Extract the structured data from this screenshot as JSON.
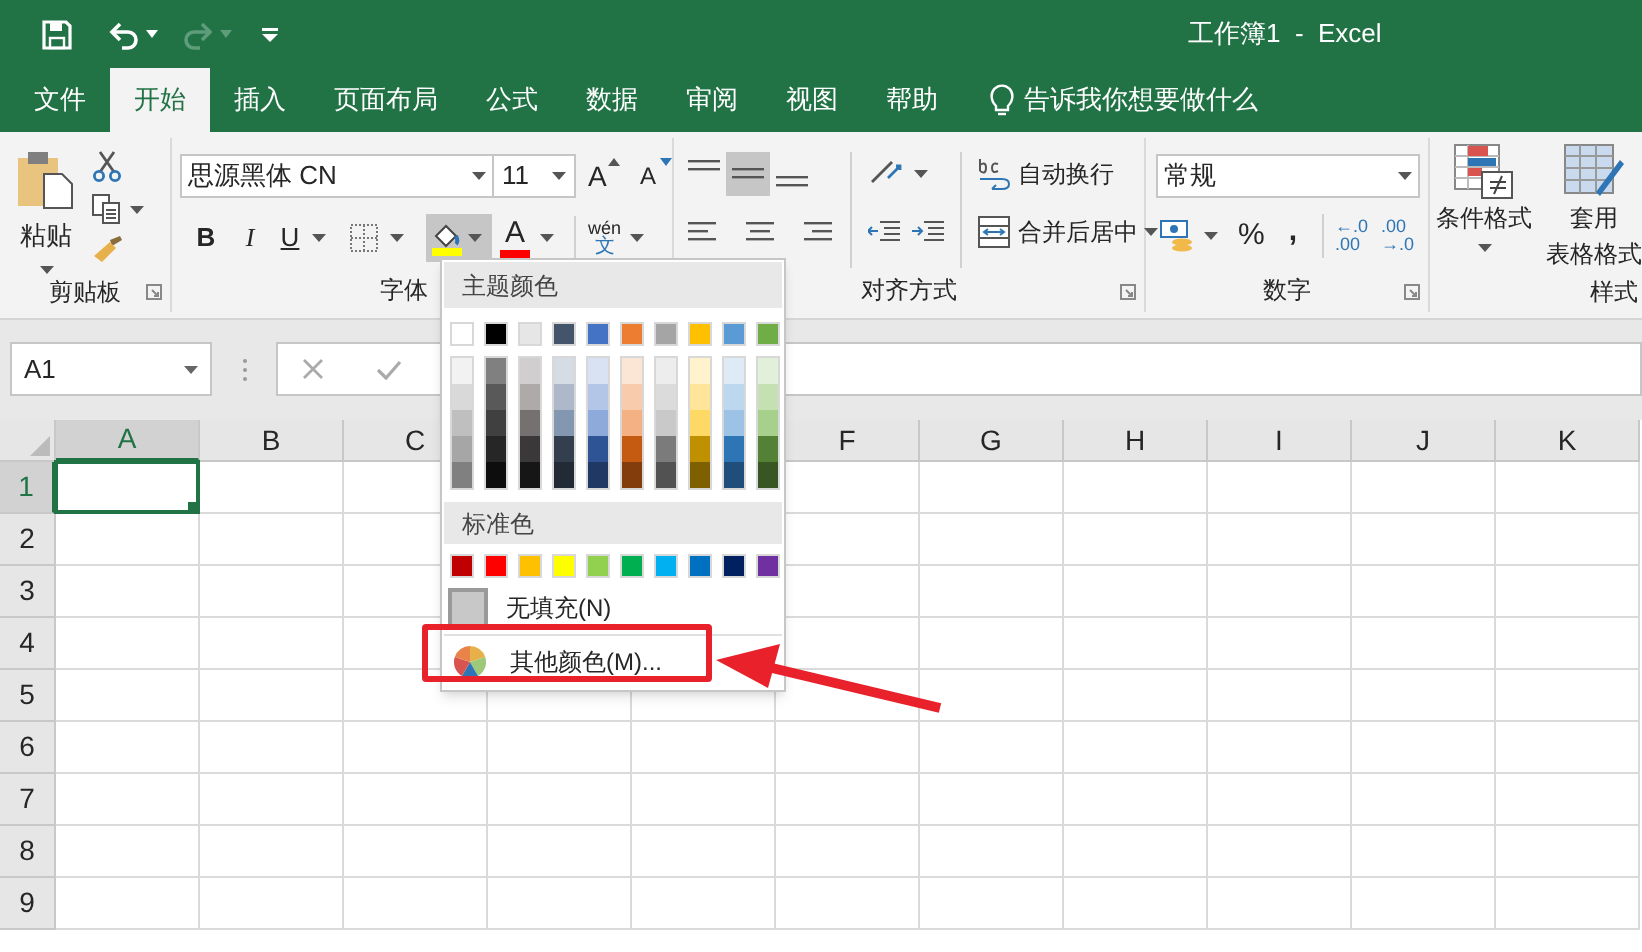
{
  "title_bar": {
    "title": "工作簿1  -  Excel",
    "quick_access": [
      {
        "kind": "undo",
        "disabled": false
      },
      {
        "kind": "redo",
        "disabled": true
      }
    ]
  },
  "tabs": [
    {
      "label": "文件",
      "selected": false
    },
    {
      "label": "开始",
      "selected": true
    },
    {
      "label": "插入",
      "selected": false
    },
    {
      "label": "页面布局",
      "selected": false
    },
    {
      "label": "公式",
      "selected": false
    },
    {
      "label": "数据",
      "selected": false
    },
    {
      "label": "审阅",
      "selected": false
    },
    {
      "label": "视图",
      "selected": false
    },
    {
      "label": "帮助",
      "selected": false
    }
  ],
  "tell_me": "告诉我你想要做什么",
  "ribbon": {
    "clipboard": {
      "paste": "粘贴",
      "label": "剪贴板"
    },
    "font": {
      "font_name": "思源黑体 CN",
      "font_size": "11",
      "grow": "A",
      "shrink": "A",
      "bold": "B",
      "italic": "I",
      "underline": "U",
      "fill_pressed": true,
      "fill_color": {
        "color": "#ffff00"
      },
      "font_color_letter": "A",
      "font_color": {
        "color": "#ff0000"
      },
      "phonetic_top": "wén",
      "phonetic_bottom": "文",
      "label": "字体"
    },
    "alignment": {
      "middle_align_pressed": true,
      "wrap_text": "自动换行",
      "merge_center": "合并后居中",
      "label": "对齐方式"
    },
    "number": {
      "format": "常规",
      "percent": "%",
      "comma": ",",
      "increase_decimal": [
        "←.0",
        ".00"
      ],
      "decrease_decimal": [
        ".00",
        "→.0"
      ],
      "label": "数字"
    },
    "styles": {
      "conditional_formatting": "条件格式",
      "format_as_table": [
        "套用",
        "表格格式"
      ],
      "label": "样式"
    }
  },
  "formula_bar": {
    "name_box": "A1"
  },
  "sheet": {
    "columns_left": [
      {
        "label": "A",
        "selected": true
      },
      {
        "label": "B",
        "selected": false
      },
      {
        "label": "C",
        "selected": false
      }
    ],
    "columns_right": [
      {
        "label": "F",
        "selected": false
      },
      {
        "label": "G",
        "selected": false
      },
      {
        "label": "H",
        "selected": false
      },
      {
        "label": "I",
        "selected": false
      },
      {
        "label": "J",
        "selected": false
      },
      {
        "label": "K",
        "selected": false
      }
    ],
    "rows": [
      {
        "label": "1",
        "selected": true
      },
      {
        "label": "2",
        "selected": false
      },
      {
        "label": "3",
        "selected": false
      },
      {
        "label": "4",
        "selected": false
      },
      {
        "label": "5",
        "selected": false
      },
      {
        "label": "6",
        "selected": false
      },
      {
        "label": "7",
        "selected": false
      },
      {
        "label": "8",
        "selected": false
      },
      {
        "label": "9",
        "selected": false
      }
    ]
  },
  "fill_color_menu": {
    "theme_heading": "主题颜色",
    "theme_colors": [
      {
        "color": "#ffffff",
        "shades": [
          {
            "color": "#f2f2f2"
          },
          {
            "color": "#d9d9d9"
          },
          {
            "color": "#bfbfbf"
          },
          {
            "color": "#a6a6a6"
          },
          {
            "color": "#808080"
          }
        ]
      },
      {
        "color": "#000000",
        "shades": [
          {
            "color": "#808080"
          },
          {
            "color": "#595959"
          },
          {
            "color": "#404040"
          },
          {
            "color": "#262626"
          },
          {
            "color": "#0d0d0d"
          }
        ]
      },
      {
        "color": "#e7e6e6",
        "shades": [
          {
            "color": "#d0cece"
          },
          {
            "color": "#aeaaaa"
          },
          {
            "color": "#757171"
          },
          {
            "color": "#3a3838"
          },
          {
            "color": "#171616"
          }
        ]
      },
      {
        "color": "#44546a",
        "shades": [
          {
            "color": "#d6dce4"
          },
          {
            "color": "#adb9ca"
          },
          {
            "color": "#8497b0"
          },
          {
            "color": "#333f4f"
          },
          {
            "color": "#222a35"
          }
        ]
      },
      {
        "color": "#4472c4",
        "shades": [
          {
            "color": "#d9e2f3"
          },
          {
            "color": "#b4c6e7"
          },
          {
            "color": "#8eaadb"
          },
          {
            "color": "#2f5496"
          },
          {
            "color": "#1f3864"
          }
        ]
      },
      {
        "color": "#ed7d31",
        "shades": [
          {
            "color": "#fbe5d5"
          },
          {
            "color": "#f7cbac"
          },
          {
            "color": "#f4b183"
          },
          {
            "color": "#c55a11"
          },
          {
            "color": "#833c0b"
          }
        ]
      },
      {
        "color": "#a5a5a5",
        "shades": [
          {
            "color": "#ededed"
          },
          {
            "color": "#dbdbdb"
          },
          {
            "color": "#c9c9c9"
          },
          {
            "color": "#7b7b7b"
          },
          {
            "color": "#525252"
          }
        ]
      },
      {
        "color": "#ffc000",
        "shades": [
          {
            "color": "#fff2cc"
          },
          {
            "color": "#fee599"
          },
          {
            "color": "#ffd965"
          },
          {
            "color": "#bf9000"
          },
          {
            "color": "#7f6000"
          }
        ]
      },
      {
        "color": "#5b9bd5",
        "shades": [
          {
            "color": "#deebf6"
          },
          {
            "color": "#bdd7ee"
          },
          {
            "color": "#9cc3e5"
          },
          {
            "color": "#2e75b5"
          },
          {
            "color": "#1e4e79"
          }
        ]
      },
      {
        "color": "#70ad47",
        "shades": [
          {
            "color": "#e2efd9"
          },
          {
            "color": "#c5e0b3"
          },
          {
            "color": "#a8d08d"
          },
          {
            "color": "#538135"
          },
          {
            "color": "#375623"
          }
        ]
      }
    ],
    "standard_heading": "标准色",
    "standard_colors": [
      {
        "color": "#c00000"
      },
      {
        "color": "#ff0000"
      },
      {
        "color": "#ffc000"
      },
      {
        "color": "#ffff00"
      },
      {
        "color": "#92d050"
      },
      {
        "color": "#00b050"
      },
      {
        "color": "#00b0f0"
      },
      {
        "color": "#0070c0"
      },
      {
        "color": "#002060"
      },
      {
        "color": "#7030a0"
      }
    ],
    "no_fill": "无填充(N)",
    "more_colors": "其他颜色(M)..."
  }
}
